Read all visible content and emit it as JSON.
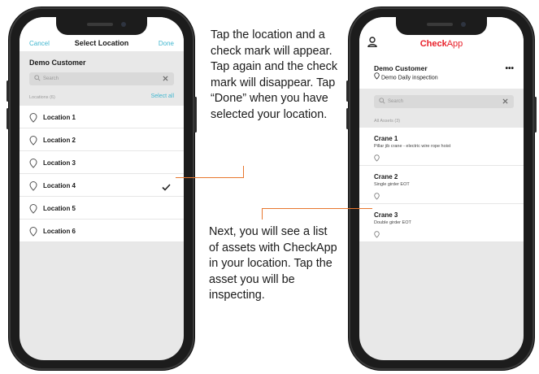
{
  "left_phone": {
    "nav": {
      "cancel": "Cancel",
      "title": "Select Location",
      "done": "Done"
    },
    "customer": "Demo Customer",
    "search_placeholder": "Search",
    "locations_label": "Locations (6)",
    "select_all": "Select all",
    "locations": [
      {
        "label": "Location 1",
        "checked": false
      },
      {
        "label": "Location 2",
        "checked": false
      },
      {
        "label": "Location 3",
        "checked": false
      },
      {
        "label": "Location 4",
        "checked": true
      },
      {
        "label": "Location 5",
        "checked": false
      },
      {
        "label": "Location 6",
        "checked": false
      }
    ]
  },
  "right_phone": {
    "brand_bold": "Check",
    "brand_regular": "App",
    "customer": "Demo Customer",
    "inspection": "Demo Daily inspection",
    "more": "•••",
    "search_placeholder": "Search",
    "assets_label": "All Assets (3)",
    "assets": [
      {
        "name": "Crane 1",
        "desc": "Pillar jib crane - electric wire rope hoist"
      },
      {
        "name": "Crane 2",
        "desc": "Single girder EOT"
      },
      {
        "name": "Crane 3",
        "desc": "Double girder EOT"
      }
    ]
  },
  "instructions": {
    "step1": "Tap the location and a check mark will appear. Tap again and the check mark will disappear. Tap “Done” when you have selected your location.",
    "step2": "Next, you will see a list of assets with CheckApp in your location. Tap the asset you will be inspecting."
  },
  "colors": {
    "accent": "#3fb6cf",
    "brand": "#e8202a",
    "connector": "#e8772e",
    "screen_bg": "#e8e8e8"
  },
  "icons": {
    "pin": "map-pin-icon",
    "check": "checkmark-icon",
    "search": "search-icon",
    "clear": "close-icon",
    "user": "user-icon",
    "more": "more-horizontal-icon"
  }
}
